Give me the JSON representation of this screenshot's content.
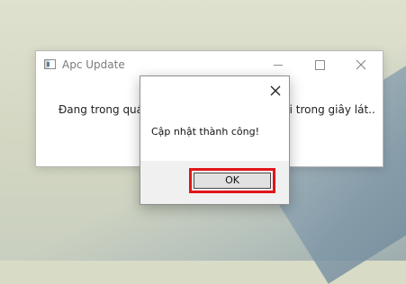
{
  "main_window": {
    "title": "Apc Update",
    "message": "Đang trong quá trình cập nhật, vui lòng đợi trong giây lát..",
    "icon": "app-window-icon"
  },
  "dialog": {
    "message": "Cập nhật thành công!",
    "ok_label": "OK",
    "close_icon": "close-icon",
    "highlight_color": "#e0161b"
  }
}
